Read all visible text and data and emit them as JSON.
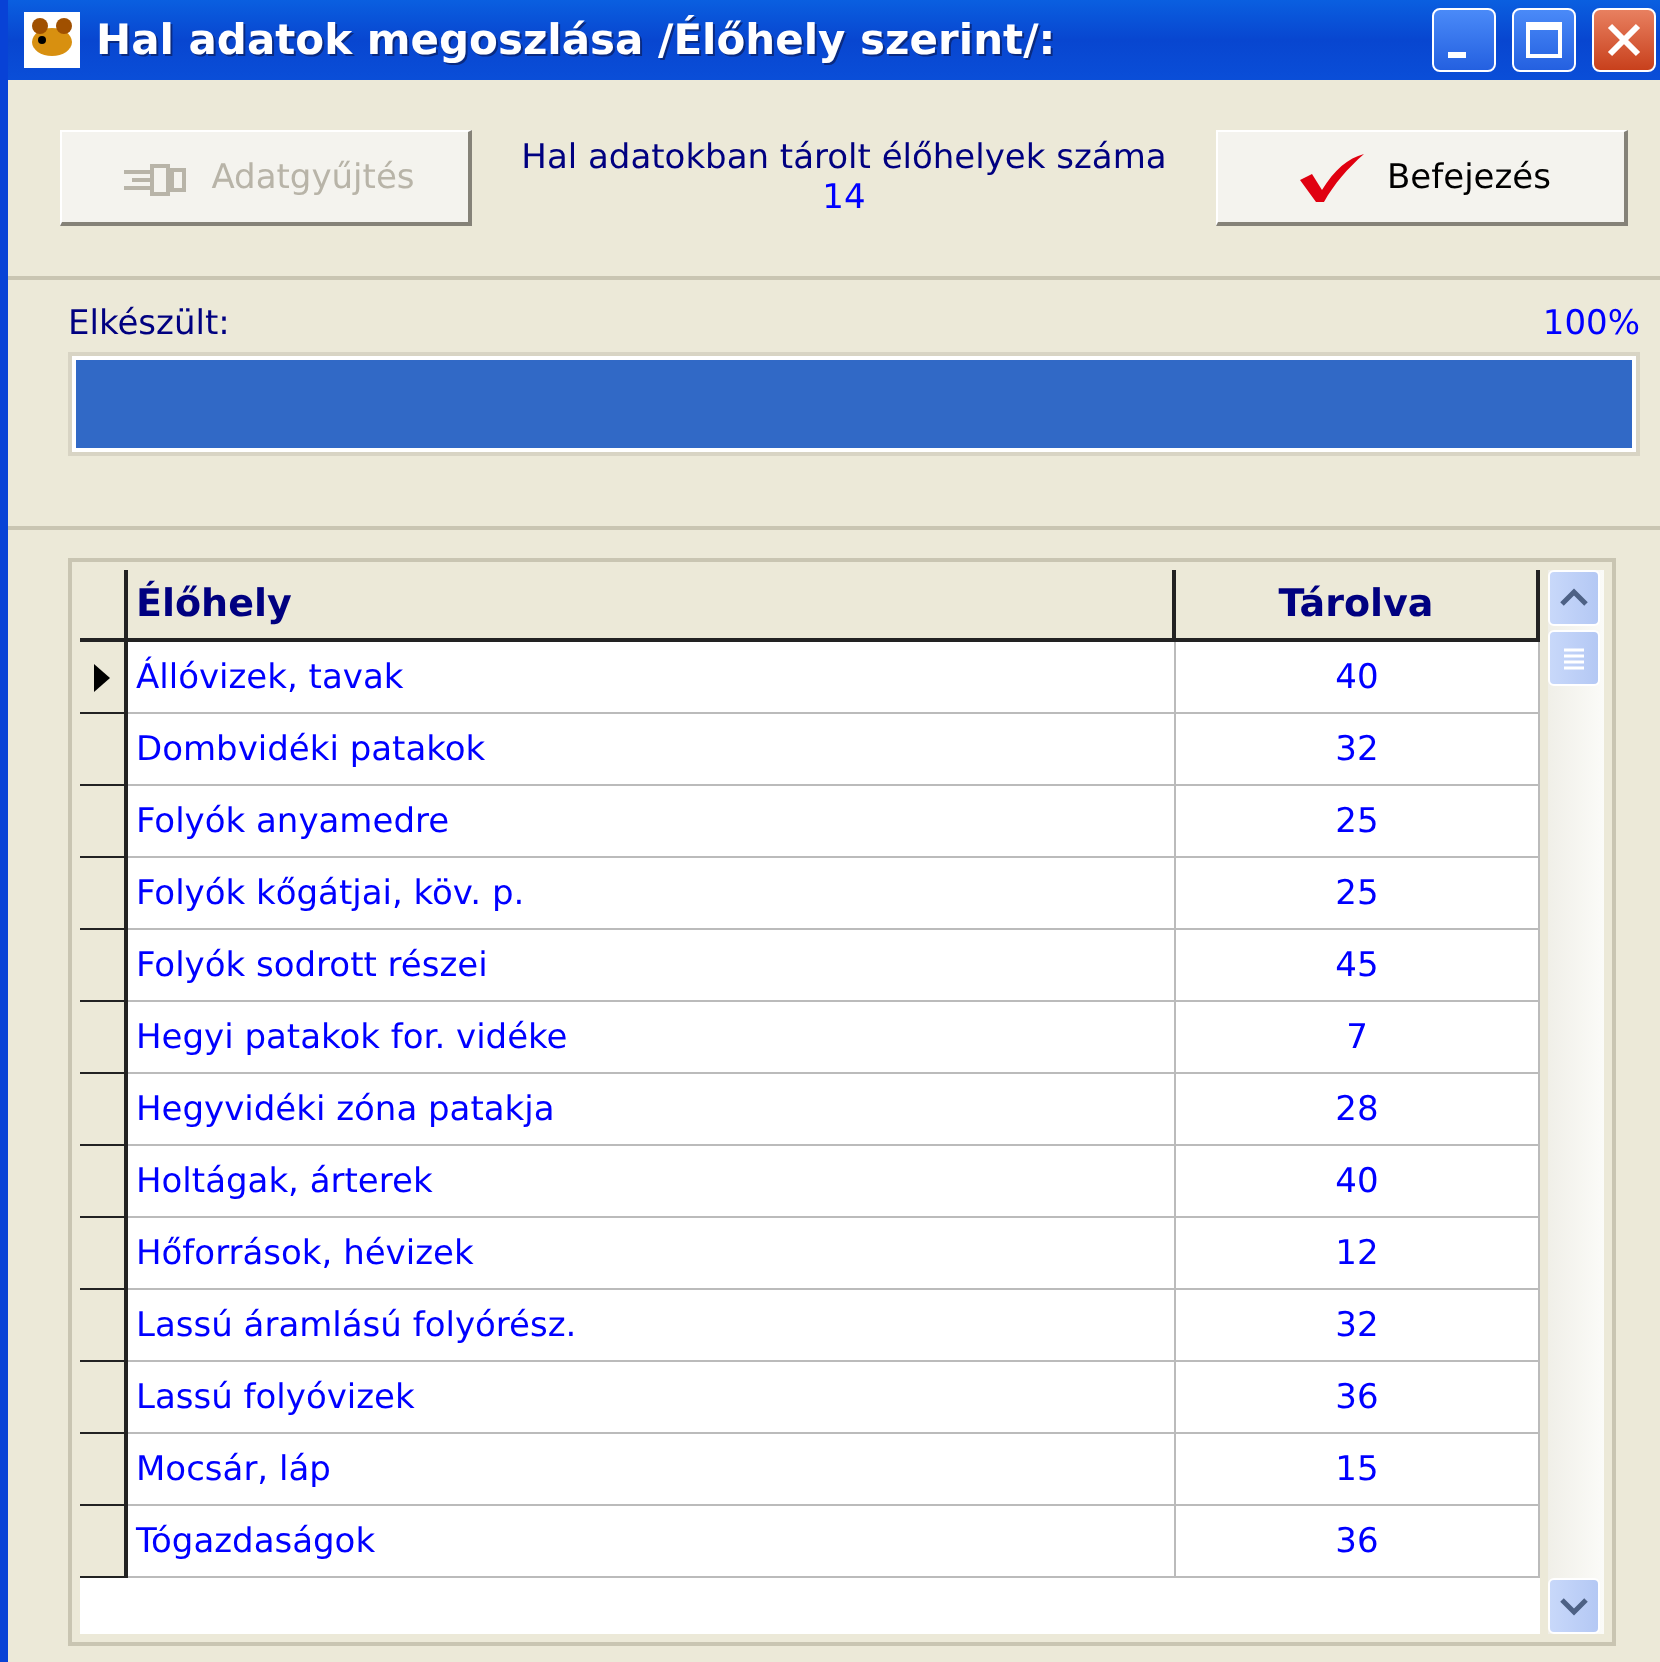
{
  "window": {
    "title": "Hal adatok megoszlása /Élőhely szerint/:"
  },
  "toolbar": {
    "collect_button": {
      "label": "Adatgyűjtés",
      "disabled": true
    },
    "count_label": "Hal adatokban tárolt élőhelyek száma",
    "count_value": "14",
    "finish_button": {
      "label": "Befejezés",
      "disabled": false
    }
  },
  "progress": {
    "label": "Elkészült:",
    "reading": "100%",
    "level": 1
  },
  "table": {
    "columns": [
      "Élőhely",
      "Tárolva"
    ],
    "rows": [
      {
        "cells": [
          "Állóvizek, tavak",
          "40"
        ],
        "selected": true
      },
      {
        "cells": [
          "Dombvidéki patakok",
          "32"
        ],
        "selected": false
      },
      {
        "cells": [
          "Folyók anyamedre",
          "25"
        ],
        "selected": false
      },
      {
        "cells": [
          "Folyók kőgátjai, köv. p.",
          "25"
        ],
        "selected": false
      },
      {
        "cells": [
          "Folyók sodrott részei",
          "45"
        ],
        "selected": false
      },
      {
        "cells": [
          "Hegyi patakok for. vidéke",
          "7"
        ],
        "selected": false
      },
      {
        "cells": [
          "Hegyvidéki zóna patakja",
          "28"
        ],
        "selected": false
      },
      {
        "cells": [
          "Holtágak, árterek",
          "40"
        ],
        "selected": false
      },
      {
        "cells": [
          "Hőforrások, hévizek",
          "12"
        ],
        "selected": false
      },
      {
        "cells": [
          "Lassú áramlású folyórész.",
          "32"
        ],
        "selected": false
      },
      {
        "cells": [
          "Lassú folyóvizek",
          "36"
        ],
        "selected": false
      },
      {
        "cells": [
          "Mocsár, láp",
          "15"
        ],
        "selected": false
      },
      {
        "cells": [
          "Tógazdaságok",
          "36"
        ],
        "selected": false
      }
    ]
  }
}
